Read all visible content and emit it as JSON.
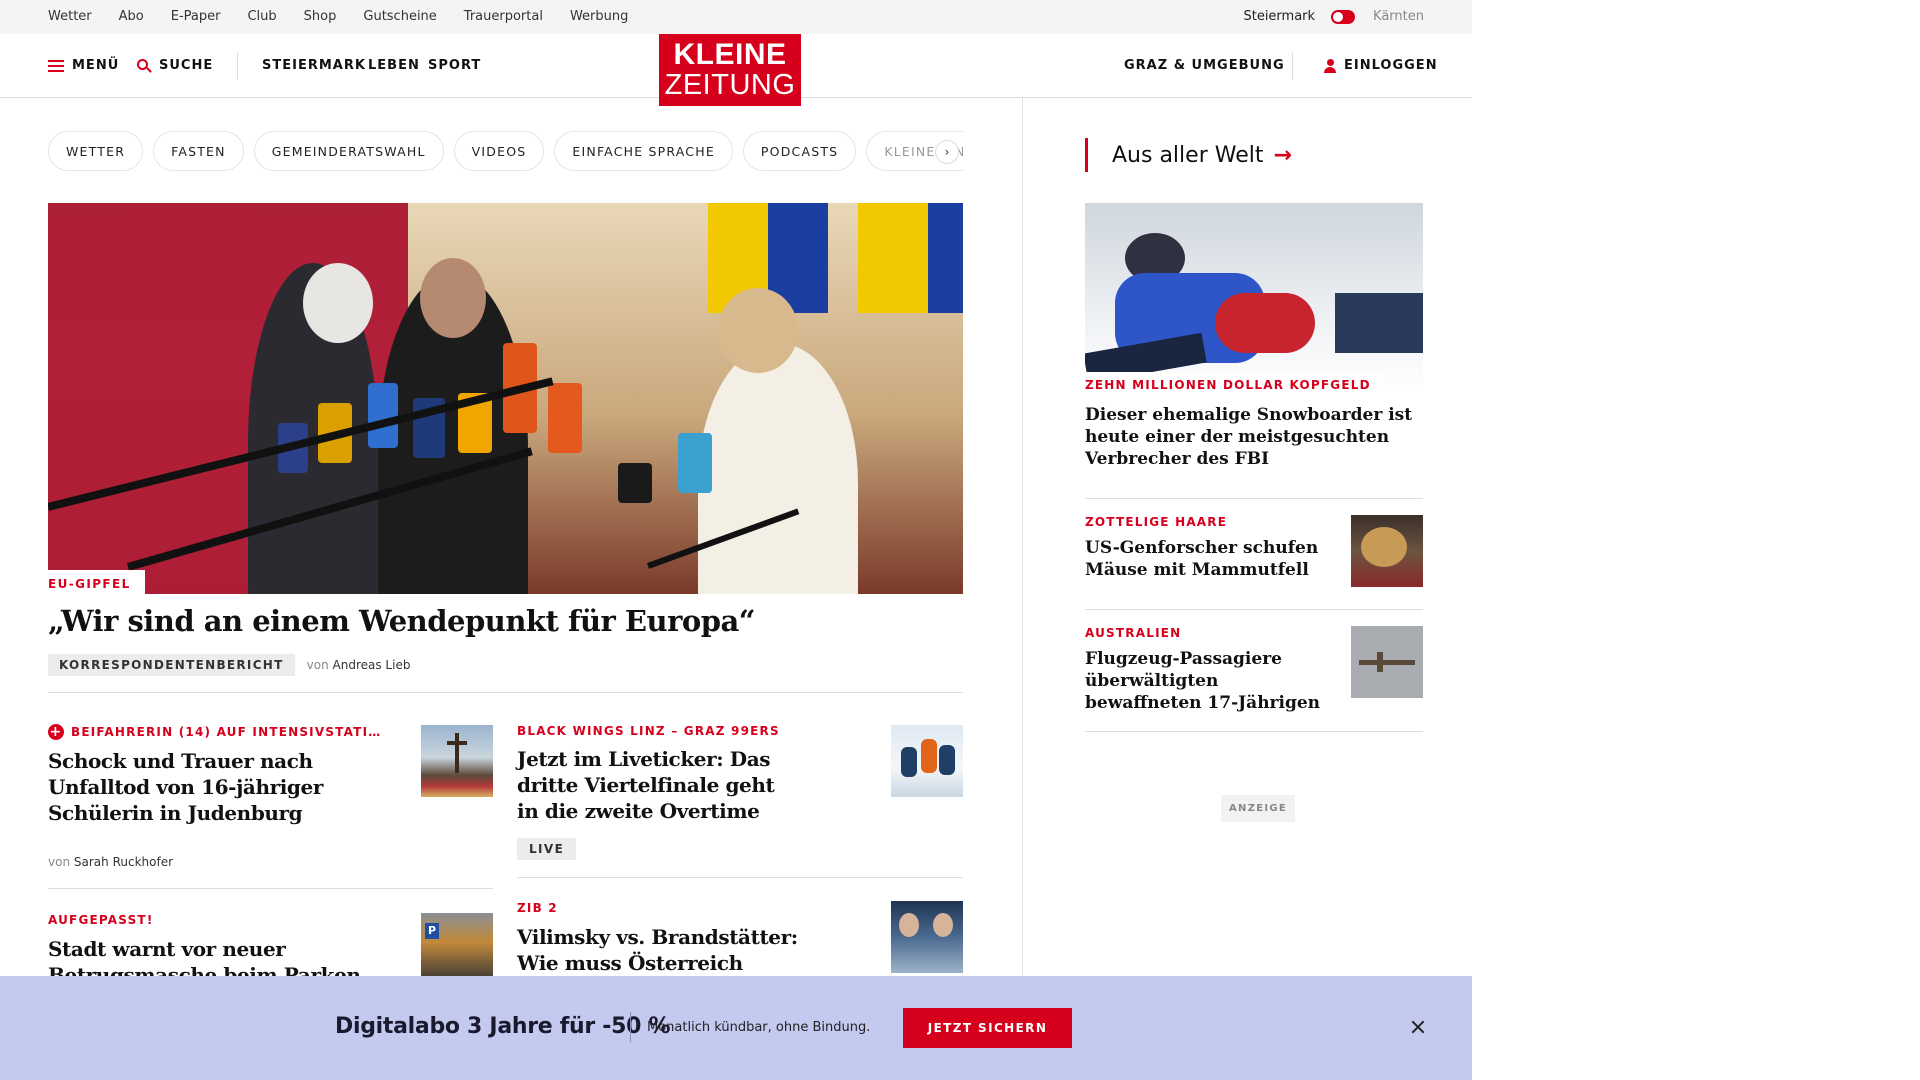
{
  "topbar": {
    "links": [
      "Wetter",
      "Abo",
      "E-Paper",
      "Club",
      "Shop",
      "Gutscheine",
      "Trauerportal",
      "Werbung"
    ],
    "region_active": "Steiermark",
    "region_inactive": "Kärnten"
  },
  "header": {
    "menu_label": "MENÜ",
    "search_label": "SUCHE",
    "nav": [
      "STEIERMARK",
      "LEBEN",
      "SPORT"
    ],
    "logo_line1": "KLEINE",
    "logo_line2": "ZEITUNG",
    "region_link": "GRAZ & UMGEBUNG",
    "login_label": "EINLOGGEN"
  },
  "chips": [
    "WETTER",
    "FASTEN",
    "GEMEINDERATSWAHL",
    "VIDEOS",
    "EINFACHE SPRACHE",
    "PODCASTS",
    "KLEINE KINDE"
  ],
  "hero": {
    "kicker": "EU-GIPFEL",
    "title": "„Wir sind an einem Wendepunkt für Europa“",
    "badge": "KORRESPONDENTENBERICHT",
    "von": "von",
    "author": "Andreas Lieb"
  },
  "articles": [
    {
      "kicker": "BEIFAHRERIN (14) AUF INTENSIVSTATI…",
      "title_lines": [
        "Schock und Trauer nach",
        "Unfalltod von 16-jähriger",
        "Schülerin in Judenburg"
      ],
      "von": "von",
      "author": "Sarah Ruckhofer"
    },
    {
      "kicker": "BLACK WINGS LINZ – GRAZ 99ERS",
      "title_lines": [
        "Jetzt im Liveticker: Das",
        "dritte Viertelfinale geht",
        "in die zweite Overtime"
      ],
      "badge": "LIVE"
    },
    {
      "kicker": "AUFGEPASST!",
      "title_lines": [
        "Stadt warnt vor neuer",
        "Betrugsmasche beim Parken"
      ]
    },
    {
      "kicker": "ZIB 2",
      "title_lines": [
        "Vilimsky vs. Brandstätter:",
        "Wie muss Österreich"
      ]
    }
  ],
  "sidebar": {
    "heading": "Aus aller Welt",
    "items": [
      {
        "kicker": "ZEHN MILLIONEN DOLLAR KOPFGELD",
        "title_lines": [
          "Dieser ehemalige Snowboarder ist",
          "heute einer der meistgesuchten",
          "Verbrecher des FBI"
        ]
      },
      {
        "kicker": "ZOTTELIGE HAARE",
        "title_lines": [
          "US-Genforscher schufen",
          "Mäuse mit Mammutfell"
        ]
      },
      {
        "kicker": "AUSTRALIEN",
        "title_lines": [
          "Flugzeug-Passagiere",
          "überwältigten",
          "bewaffneten 17-Jährigen"
        ]
      }
    ],
    "ad_label": "ANZEIGE"
  },
  "banner": {
    "promo": "Digitalabo 3 Jahre für -50 %",
    "sub": "Monatlich kündbar, ohne Bindung.",
    "cta": "JETZT SICHERN"
  },
  "colors": {
    "brand_red": "#d6001c",
    "banner_bg": "#c4c9ef"
  }
}
